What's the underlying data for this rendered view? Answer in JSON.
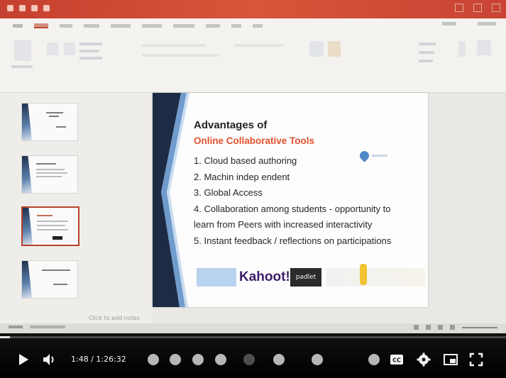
{
  "slide": {
    "title": "Advantages of",
    "subtitle": "Online Collaborative Tools",
    "items": [
      "1. Cloud based authoring",
      "2. Machin  indep endent",
      "3. Global Access",
      "4. Collaboration among students - opportunity to",
      "learn from Peers with increased interactivity",
      "5. Instant feedback / reflections on participations"
    ],
    "tool_logos": {
      "kahoot": "Kahoot!",
      "padlet": "padlet"
    }
  },
  "notes_placeholder": "Click to add notes",
  "player": {
    "time": "1:48 / 1:26:32",
    "progress_fraction": 0.02
  },
  "colors": {
    "titlebar": "#c6402f",
    "slide_title": "#232323",
    "slide_subtitle": "#e0522c",
    "selected_thumb_border": "#b8412c",
    "player_bg": "#000000"
  },
  "icons": {
    "play": "play-icon",
    "volume": "volume-icon",
    "captions": "captions-icon",
    "settings": "gear-icon",
    "miniplayer": "miniplayer-icon",
    "fullscreen": "fullscreen-icon"
  }
}
